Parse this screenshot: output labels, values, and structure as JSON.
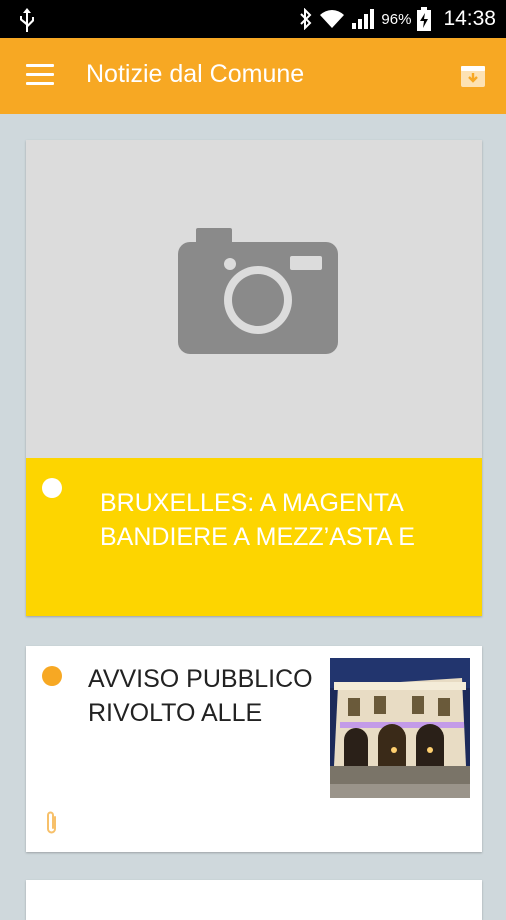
{
  "status_bar": {
    "battery_percent": "96%",
    "time": "14:38",
    "icons": [
      "usb-icon",
      "bluetooth-icon",
      "wifi-icon",
      "signal-icon",
      "battery-icon"
    ]
  },
  "app_bar": {
    "title": "Notizie dal Comune",
    "icons": [
      "menu-icon",
      "archive-icon"
    ],
    "background_color": "#f7a823"
  },
  "news": [
    {
      "headline": "BRUXELLES: A MAGENTA BANDIERE A MEZZ’ASTA E",
      "image": "camera-placeholder-icon",
      "band_color": "#fdd500",
      "dot_color": "#ffffff"
    },
    {
      "headline": "AVVISO PUBBLICO RIVOLTO ALLE",
      "image": "building-night-photo",
      "dot_color": "#f7a823",
      "attachment": "paperclip-icon"
    }
  ]
}
